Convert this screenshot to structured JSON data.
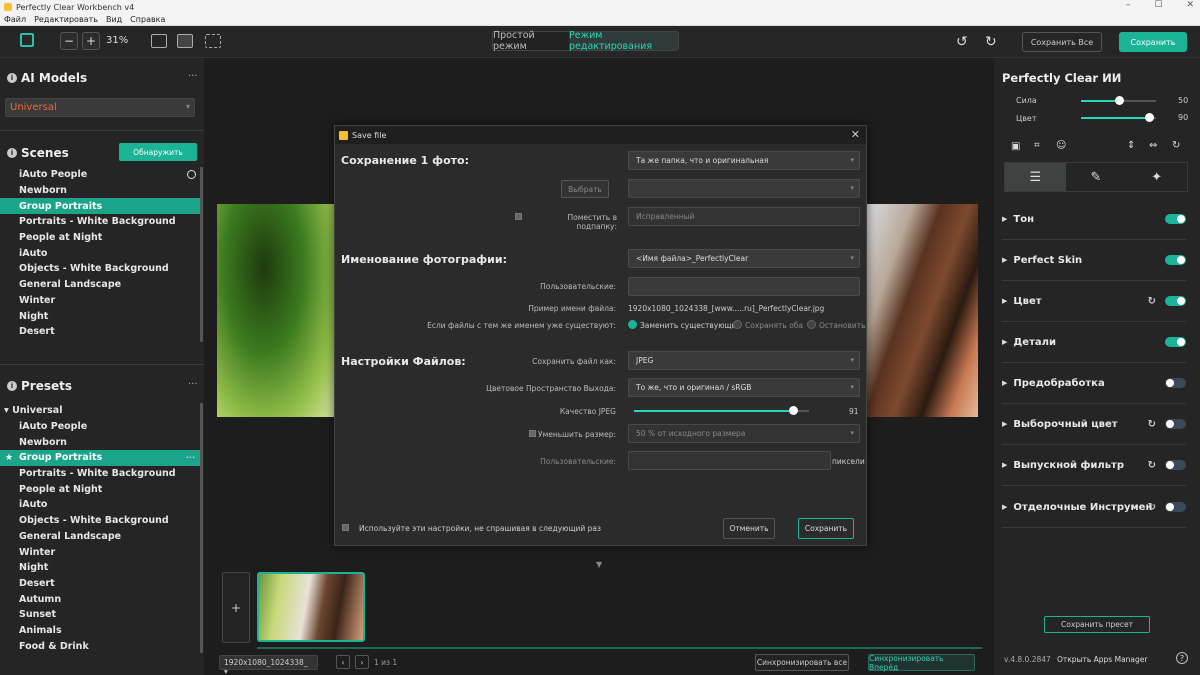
{
  "window": {
    "title": "Perfectly Clear Workbench v4",
    "controls": [
      "–",
      "☐",
      "✕"
    ]
  },
  "menu": [
    "Файл",
    "Редактировать",
    "Вид",
    "Справка"
  ],
  "toolbar": {
    "zoom_minus": "−",
    "zoom_plus": "+",
    "zoom": "31%",
    "mode_simple": "Простой режим",
    "mode_edit": "Режим редактирования",
    "undo": "↺",
    "redo": "↻",
    "save_all": "Сохранить Все",
    "save": "Сохранить"
  },
  "ai_models": {
    "title": "AI Models",
    "more": "···",
    "selected": "Universal"
  },
  "scenes": {
    "title": "Scenes",
    "detect": "Обнаружить",
    "items": [
      "iAuto People",
      "Newborn",
      "Group Portraits",
      "Portraits - White Background",
      "People at Night",
      "iAuto",
      "Objects - White Background",
      "General Landscape",
      "Winter",
      "Night",
      "Desert"
    ]
  },
  "presets": {
    "title": "Presets",
    "more": "···",
    "group": "Universal",
    "items": [
      "iAuto People",
      "Newborn",
      "Group Portraits",
      "Portraits - White Background",
      "People at Night",
      "iAuto",
      "Objects - White Background",
      "General Landscape",
      "Winter",
      "Night",
      "Desert",
      "Autumn",
      "Sunset",
      "Animals",
      "Food & Drink"
    ]
  },
  "dialog": {
    "title": "Save file",
    "close": "✕",
    "section_save": "Сохранение 1 фото:",
    "folder_value": "Та же папка, что и оригинальная",
    "browse": "Выбрать",
    "browse_value": "",
    "subfolder_label": "Поместить в подпапку:",
    "subfolder_value": "Исправленный",
    "section_naming": "Именование фотографии:",
    "naming_value": "<Имя файла>_PerfectlyClear",
    "custom_label": "Пользовательские:",
    "custom_value": "",
    "example_label": "Пример имени файла:",
    "example_value": "1920x1080_1024338_[www.....ru]_PerfectlyClear.jpg",
    "exists_label": "Если файлы с тем же именем уже существуют:",
    "exists_options": [
      "Заменить существующие",
      "Сохранять оба",
      "Остановить"
    ],
    "section_files": "Настройки Файлов:",
    "save_as_label": "Сохранить файл как:",
    "save_as_value": "JPEG",
    "color_space_label": "Цветовое Пространство Выхода:",
    "color_space_value": "То же, что и оригинал / sRGB",
    "quality_label": "Качество JPEG",
    "quality_value": 91,
    "resize_label": "Уменьшить размер:",
    "resize_value": "50 % от исходного размера",
    "custom2_label": "Пользовательские:",
    "custom2_value": "",
    "pixels": "пиксели",
    "remember": "Используйте эти настройки, не спрашивая в следующий раз",
    "cancel": "Отменить",
    "save": "Сохранить"
  },
  "filmstrip": {
    "add": "+",
    "file": "1920x1080_1024338_",
    "prev": "‹",
    "next": "›",
    "page": "1 из 1",
    "sync_all": "Синхронизировать все",
    "sync_forward": "Синхронизировать Вперёд"
  },
  "right_panel": {
    "title": "Perfectly Clear ИИ",
    "strength_label": "Сила",
    "strength_value": 50,
    "color_label": "Цвет",
    "color_value": 90,
    "sections": [
      {
        "name": "Тон",
        "on": true,
        "reset": false
      },
      {
        "name": "Perfect Skin",
        "on": true,
        "reset": false
      },
      {
        "name": "Цвет",
        "on": true,
        "reset": true
      },
      {
        "name": "Детали",
        "on": true,
        "reset": false
      },
      {
        "name": "Предобработка",
        "on": false,
        "reset": false
      },
      {
        "name": "Выборочный цвет",
        "on": false,
        "reset": true
      },
      {
        "name": "Выпускной фильтр",
        "on": false,
        "reset": true
      },
      {
        "name": "Отделочные Инструмент",
        "on": false,
        "reset": true
      }
    ],
    "save_preset": "Сохранить пресет",
    "version": "v.4.8.0.2847",
    "apps_manager": "Открыть Apps Manager",
    "help": "?"
  },
  "colors": {
    "accent": "#1bb496",
    "model": "#e76a3f"
  }
}
